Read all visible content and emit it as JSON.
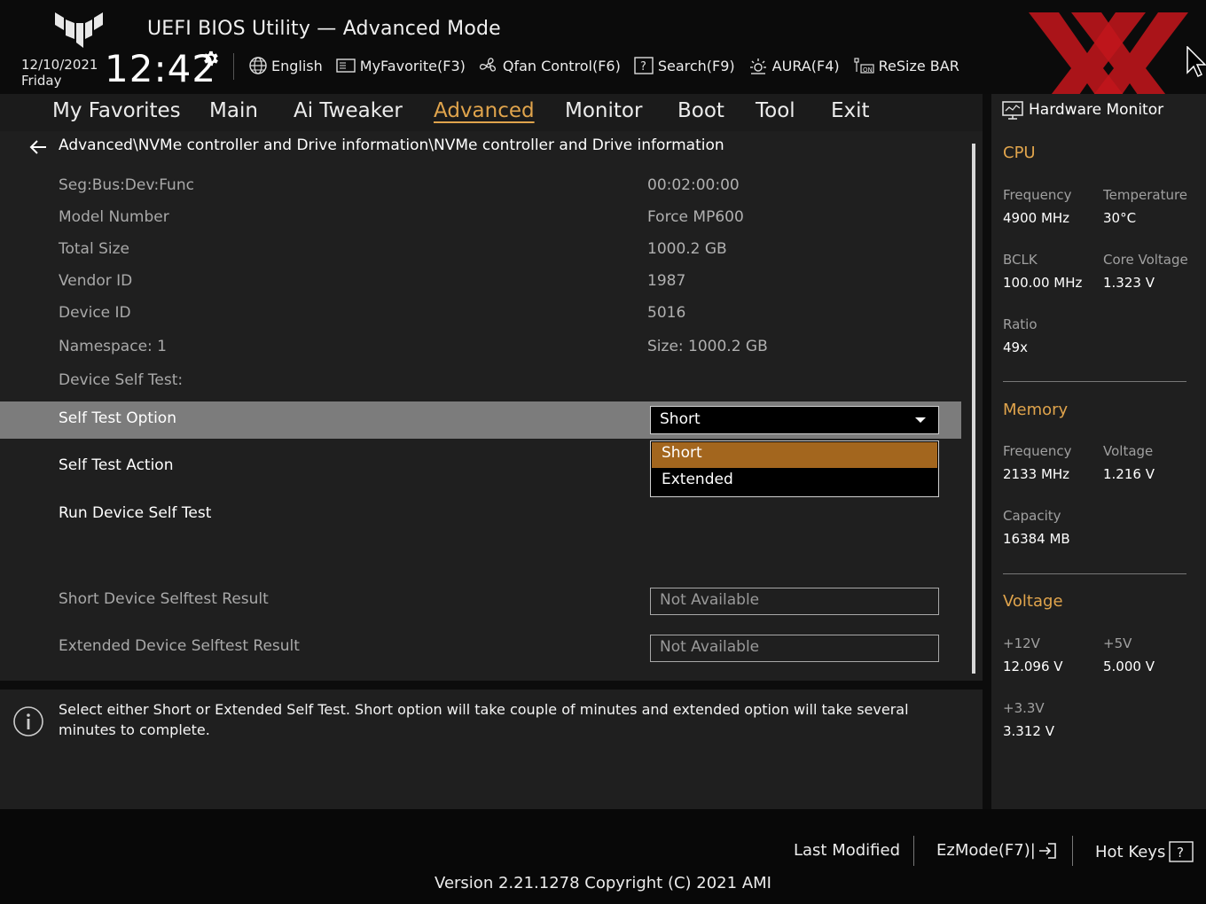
{
  "header": {
    "title": "UEFI BIOS Utility — Advanced Mode",
    "date": "12/10/2021",
    "day": "Friday",
    "time": "12:42",
    "toolbar": [
      {
        "label": "English",
        "icon": "globe-icon"
      },
      {
        "label": "MyFavorite(F3)",
        "icon": "favorite-icon"
      },
      {
        "label": "Qfan Control(F6)",
        "icon": "fan-icon"
      },
      {
        "label": "Search(F9)",
        "icon": "search-icon"
      },
      {
        "label": "AURA(F4)",
        "icon": "aura-icon"
      },
      {
        "label": "ReSize BAR",
        "icon": "resize-bar-icon"
      }
    ]
  },
  "nav": {
    "tabs": [
      "My Favorites",
      "Main",
      "Ai Tweaker",
      "Advanced",
      "Monitor",
      "Boot",
      "Tool",
      "Exit"
    ],
    "active": "Advanced"
  },
  "main": {
    "breadcrumb": "Advanced\\NVMe controller and Drive information\\NVMe controller and Drive information",
    "info_rows": [
      {
        "label": "Seg:Bus:Dev:Func",
        "value": "00:02:00:00"
      },
      {
        "label": "Model Number",
        "value": "Force MP600"
      },
      {
        "label": "Total Size",
        "value": "1000.2 GB"
      },
      {
        "label": "Vendor ID",
        "value": "1987"
      },
      {
        "label": "Device ID",
        "value": "5016"
      },
      {
        "label": "Namespace: 1",
        "value": "Size: 1000.2 GB"
      }
    ],
    "self_test_header": "Device Self Test:",
    "self_test_option": {
      "label": "Self Test Option",
      "value": "Short",
      "options": [
        "Short",
        "Extended"
      ]
    },
    "self_test_action": "Self Test Action",
    "run_self_test": "Run Device Self Test",
    "short_result": {
      "label": "Short Device Selftest Result",
      "value": "Not Available"
    },
    "extended_result": {
      "label": "Extended Device Selftest Result",
      "value": "Not Available"
    }
  },
  "help": {
    "text": "Select either Short or Extended Self Test. Short option will take couple of minutes and extended option will take several minutes to complete."
  },
  "hardware_monitor": {
    "title": "Hardware Monitor",
    "cpu": {
      "title": "CPU",
      "frequency_label": "Frequency",
      "frequency": "4900 MHz",
      "temperature_label": "Temperature",
      "temperature": "30°C",
      "bclk_label": "BCLK",
      "bclk": "100.00 MHz",
      "core_voltage_label": "Core Voltage",
      "core_voltage": "1.323 V",
      "ratio_label": "Ratio",
      "ratio": "49x"
    },
    "memory": {
      "title": "Memory",
      "frequency_label": "Frequency",
      "frequency": "2133 MHz",
      "voltage_label": "Voltage",
      "voltage": "1.216 V",
      "capacity_label": "Capacity",
      "capacity": "16384 MB"
    },
    "voltage": {
      "title": "Voltage",
      "v12_label": "+12V",
      "v12": "12.096 V",
      "v5_label": "+5V",
      "v5": "5.000 V",
      "v33_label": "+3.3V",
      "v33": "3.312 V"
    }
  },
  "footer": {
    "last_modified": "Last Modified",
    "ezmode": "EzMode(F7)|",
    "hot_keys": "Hot Keys",
    "version": "Version 2.21.1278 Copyright (C) 2021 AMI"
  },
  "colors": {
    "accent": "#e0a44c",
    "selected_option": "#a3661e",
    "highlight_row": "#7c7c7c",
    "watermark": "#c0161b"
  }
}
